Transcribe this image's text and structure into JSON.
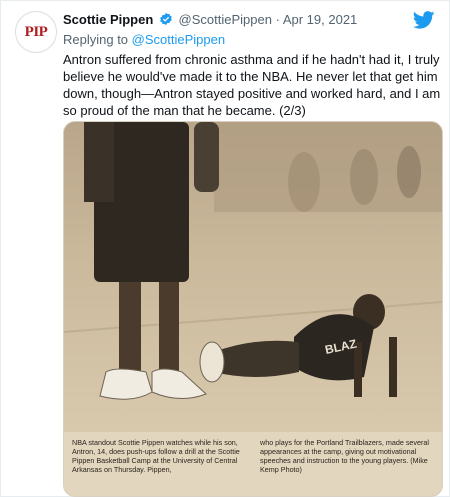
{
  "tweet": {
    "avatar_text": "PIP",
    "author_name": "Scottie Pippen",
    "handle": "@ScottiePippen",
    "separator": "·",
    "date": "Apr 19, 2021",
    "reply_prefix": "Replying to",
    "reply_handle": "@ScottiePippen",
    "text": "Antron suffered from chronic asthma and if he hadn't had it, I truly believe he would've made it to the NBA. He never let that get him down, though—Antron stayed positive and worked hard, and I am so proud of the man that he became. (2/3)",
    "caption_col1": "NBA standout Scottie Pippen watches while his son, Antron, 14, does push-ups follow a drill at the Scottie Pippen Basketball Camp at the University of Central Arkansas on Thursday. Pippen,",
    "caption_col2": "who plays for the Portland Trailblazers, made several appearances at the camp, giving out motivational speeches and instruction to the young players. (Mike Kemp Photo)"
  },
  "colors": {
    "accent": "#1d9bf0",
    "avatar_text": "#b01e23"
  },
  "icons": [
    "verified-badge-icon",
    "twitter-bird-icon"
  ]
}
